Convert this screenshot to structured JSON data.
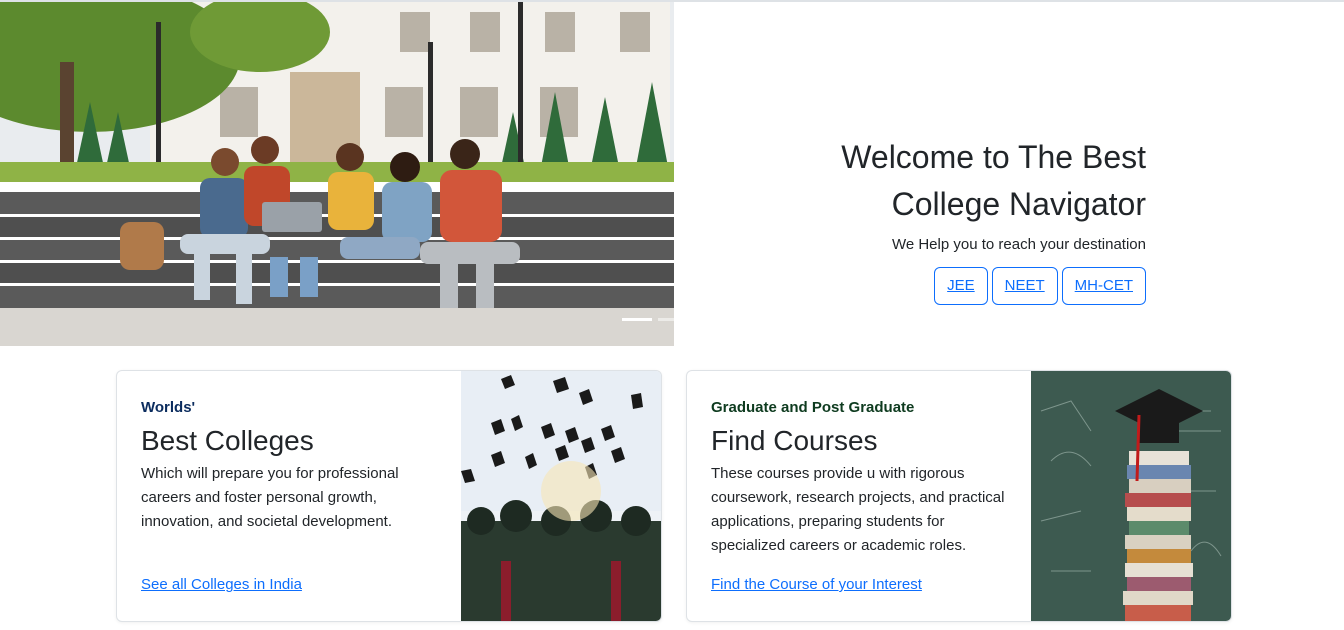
{
  "hero": {
    "title_line1": "Welcome to The Best",
    "title_line2": "College Navigator",
    "subtitle": "We Help you to reach your destination",
    "buttons": [
      "JEE",
      "NEET",
      "MH-CET"
    ],
    "carousel_active_index": 0
  },
  "cards": [
    {
      "kicker": "Worlds'",
      "title": "Best Colleges",
      "text": "Which will prepare you for professional careers and foster personal growth, innovation, and societal development.",
      "link": "See all Colleges in India"
    },
    {
      "kicker": "Graduate and Post Graduate",
      "title": "Find Courses",
      "text": "These courses provide u with rigorous coursework, research projects, and practical applications, preparing students for specialized careers or academic roles.",
      "link": "Find the Course of your Interest"
    }
  ],
  "colors": {
    "accent": "#0d6efd",
    "kicker_blue": "#0b2c5e",
    "kicker_green": "#0e3b1f"
  }
}
